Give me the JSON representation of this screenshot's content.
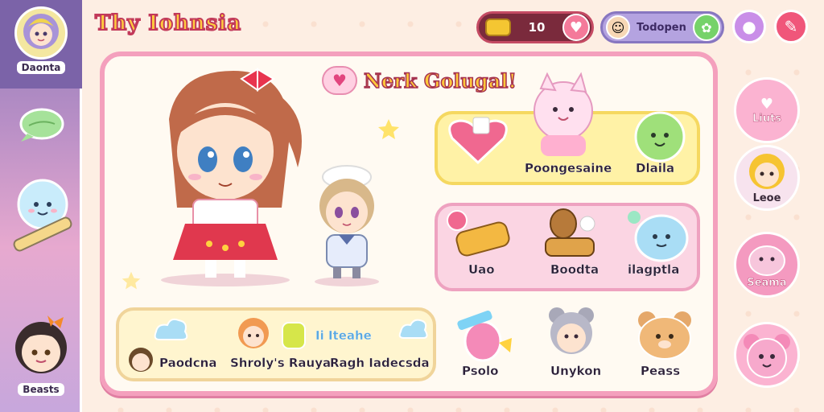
{
  "title": "Thy Iohnsia",
  "sidebar": {
    "items": [
      {
        "label": "Daonta",
        "icon": "girl-avatar-icon"
      },
      {
        "label": "",
        "icon": "leaf-icon"
      },
      {
        "label": "",
        "icon": "ghost-wand-icon"
      },
      {
        "label": "Beasts",
        "icon": "boy-avatar-icon"
      }
    ]
  },
  "topbar": {
    "coins": "10",
    "username": "Todopen"
  },
  "panel": {
    "heading": "Nerk Golugal!",
    "yellow_card": [
      {
        "label": "Poongesaine"
      },
      {
        "label": "Dlaila"
      }
    ],
    "pink_card": [
      {
        "label": "Uao"
      },
      {
        "label": "Boodta"
      },
      {
        "label": "ilagptla"
      }
    ],
    "bottom_card": [
      {
        "label": "Paodcna"
      },
      {
        "label": "Shroly's Rauya"
      },
      {
        "label": "Ragh Iadecsda"
      }
    ],
    "bottom_card_badge": "Ii Iteahe",
    "free_items": [
      {
        "label": "Psolo"
      },
      {
        "label": "Unykon"
      },
      {
        "label": "Peass"
      }
    ]
  },
  "rightbar": {
    "items": [
      {
        "label": "Liuts"
      },
      {
        "label": "Leoe"
      },
      {
        "label": "Seama"
      },
      {
        "label": ""
      }
    ]
  },
  "colors": {
    "accent_pink": "#f4a0bd",
    "title_yellow": "#ffcc3d",
    "sidebar_purple": "#8f7ab8"
  }
}
